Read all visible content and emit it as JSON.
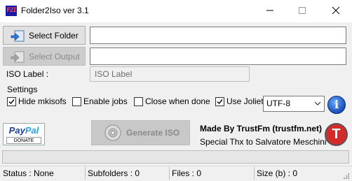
{
  "window": {
    "title": "Folder2Iso ver 3.1",
    "app_icon_text": "F2I"
  },
  "buttons": {
    "select_folder": "Select Folder",
    "select_output": "Select Output",
    "generate": "Generate ISO"
  },
  "inputs": {
    "folder_value": "",
    "output_value": "",
    "iso_label_caption": "ISO Label :",
    "iso_label_placeholder": "ISO Label"
  },
  "settings": {
    "caption": "Settings",
    "options": [
      {
        "label": "Hide mkisofs",
        "checked": true
      },
      {
        "label": "Enable jobs",
        "checked": false
      },
      {
        "label": "Close when done",
        "checked": false
      },
      {
        "label": "Use Joliet",
        "checked": true
      }
    ],
    "encoding": "UTF-8"
  },
  "donate": {
    "brand_a": "Pay",
    "brand_b": "Pal",
    "donate": "DONATE"
  },
  "credits": {
    "made_by": "Made By TrustFm (trustfm.net)",
    "thanks": "Special Thx to Salvatore Meschini",
    "logo_letter": "T"
  },
  "progress": {
    "fraction": 0.0,
    "color": "#06b025"
  },
  "status": {
    "status": "Status : None",
    "subfolders": "Subfolders : 0",
    "files": "Files : 0",
    "size": "Size (b) : 0"
  },
  "icons": {
    "app": "folder2iso-icon",
    "minimize": "minimize-icon",
    "maximize": "maximize-icon",
    "close": "close-icon",
    "select_folder": "folder-arrow-icon",
    "select_output": "output-arrow-icon",
    "generate": "disc-icon",
    "info": "info-icon",
    "dropdown": "chevron-down-icon",
    "trustfm": "trustfm-logo-icon"
  }
}
